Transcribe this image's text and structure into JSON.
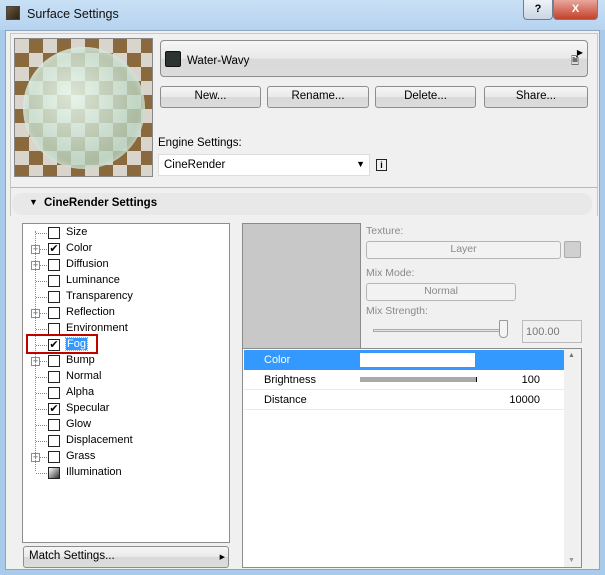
{
  "window": {
    "title": "Surface Settings",
    "help_label": "?",
    "close_label": "X"
  },
  "surface": {
    "name": "Water-Wavy",
    "swatch_color": "#2b3431"
  },
  "buttons": {
    "new": "New...",
    "rename": "Rename...",
    "delete": "Delete...",
    "share": "Share..."
  },
  "engine": {
    "label": "Engine Settings:",
    "value": "CineRender",
    "info": "i"
  },
  "section": {
    "title": "CineRender Settings"
  },
  "channels": [
    {
      "label": "Size",
      "checked": false,
      "expandable": false,
      "kind": "size"
    },
    {
      "label": "Color",
      "checked": true,
      "expandable": true
    },
    {
      "label": "Diffusion",
      "checked": false,
      "expandable": true
    },
    {
      "label": "Luminance",
      "checked": false,
      "expandable": false
    },
    {
      "label": "Transparency",
      "checked": false,
      "expandable": false
    },
    {
      "label": "Reflection",
      "checked": false,
      "expandable": true
    },
    {
      "label": "Environment",
      "checked": false,
      "expandable": false
    },
    {
      "label": "Fog",
      "checked": true,
      "expandable": false,
      "selected": true
    },
    {
      "label": "Bump",
      "checked": false,
      "expandable": true
    },
    {
      "label": "Normal",
      "checked": false,
      "expandable": false
    },
    {
      "label": "Alpha",
      "checked": false,
      "expandable": false
    },
    {
      "label": "Specular",
      "checked": true,
      "expandable": false
    },
    {
      "label": "Glow",
      "checked": false,
      "expandable": false
    },
    {
      "label": "Displacement",
      "checked": false,
      "expandable": false
    },
    {
      "label": "Grass",
      "checked": false,
      "expandable": true
    },
    {
      "label": "Illumination",
      "checked": false,
      "expandable": false,
      "kind": "illum"
    }
  ],
  "match_settings": "Match Settings...",
  "texture": {
    "label": "Texture:",
    "button": "Layer",
    "mix_mode_label": "Mix Mode:",
    "mix_mode": "Normal",
    "mix_strength_label": "Mix Strength:",
    "mix_strength": "100.00",
    "mix_strength_fraction": 1.0
  },
  "params": [
    {
      "name": "Color",
      "value": "",
      "swatch": "#ffffff"
    },
    {
      "name": "Brightness",
      "value": "100",
      "bar_fraction": 1.0
    },
    {
      "name": "Distance",
      "value": "10000"
    }
  ],
  "colors": {
    "selection": "#3399ff",
    "highlight_box": "#c00000"
  }
}
